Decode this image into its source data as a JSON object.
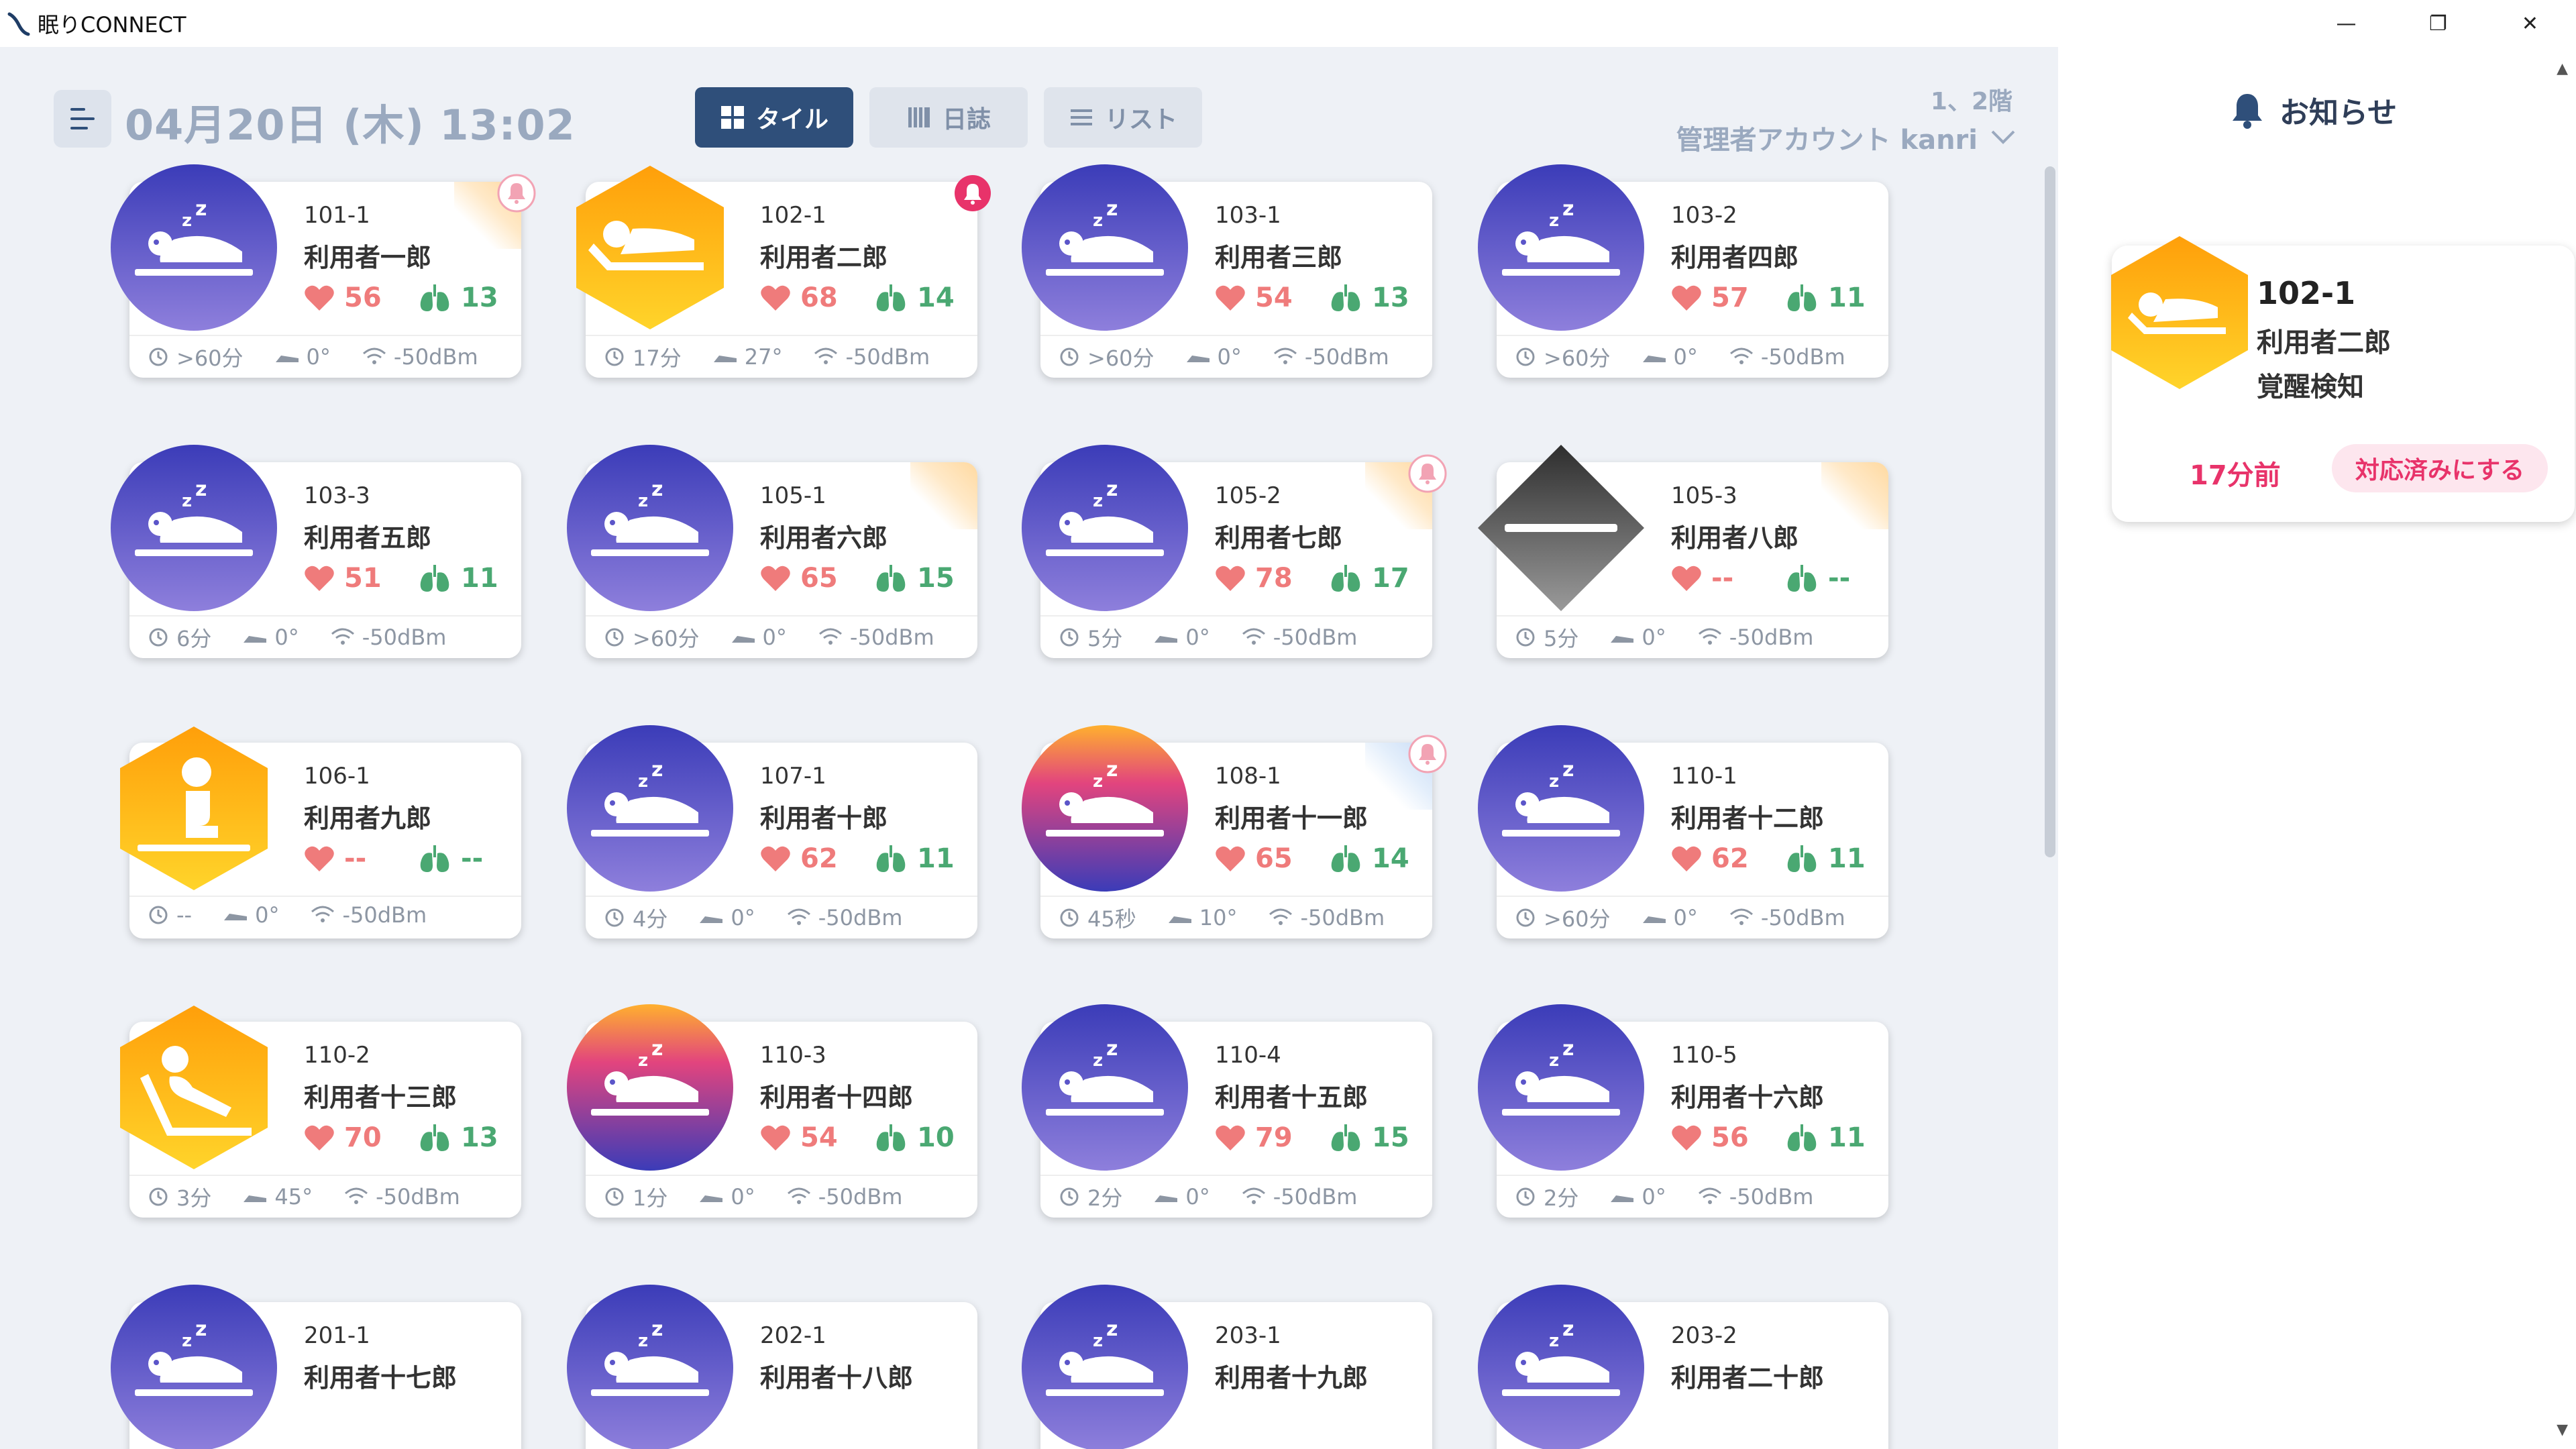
{
  "app": {
    "title": "眠りCONNECT"
  },
  "window": {
    "minimize": "—",
    "restore": "❐",
    "close": "✕"
  },
  "header": {
    "datetime": "04月20日 (木) 13:02",
    "tabs": [
      {
        "label": "タイル",
        "active": true
      },
      {
        "label": "日誌",
        "active": false
      },
      {
        "label": "リスト",
        "active": false
      }
    ],
    "floor": "1、2階",
    "account": "管理者アカウント kanri"
  },
  "colors": {
    "accent": "#2f4f7a",
    "heart": "#ef7b7b",
    "lung": "#4aa872",
    "alert": "#e8336a"
  },
  "tiles": [
    {
      "room": "101-1",
      "name": "利用者一郎",
      "hr": "56",
      "rr": "13",
      "time": ">60分",
      "angle": "0°",
      "signal": "-50dBm",
      "icon": "sleep",
      "badge": "bell",
      "corner": "orange"
    },
    {
      "room": "102-1",
      "name": "利用者二郎",
      "hr": "68",
      "rr": "14",
      "time": "17分",
      "angle": "27°",
      "signal": "-50dBm",
      "icon": "awake-reclined",
      "badge": "alarm",
      "corner": ""
    },
    {
      "room": "103-1",
      "name": "利用者三郎",
      "hr": "54",
      "rr": "13",
      "time": ">60分",
      "angle": "0°",
      "signal": "-50dBm",
      "icon": "sleep",
      "badge": "",
      "corner": ""
    },
    {
      "room": "103-2",
      "name": "利用者四郎",
      "hr": "57",
      "rr": "11",
      "time": ">60分",
      "angle": "0°",
      "signal": "-50dBm",
      "icon": "sleep",
      "badge": "",
      "corner": ""
    },
    {
      "room": "103-3",
      "name": "利用者五郎",
      "hr": "51",
      "rr": "11",
      "time": "6分",
      "angle": "0°",
      "signal": "-50dBm",
      "icon": "sleep",
      "badge": "",
      "corner": ""
    },
    {
      "room": "105-1",
      "name": "利用者六郎",
      "hr": "65",
      "rr": "15",
      "time": ">60分",
      "angle": "0°",
      "signal": "-50dBm",
      "icon": "sleep",
      "badge": "",
      "corner": "orange"
    },
    {
      "room": "105-2",
      "name": "利用者七郎",
      "hr": "78",
      "rr": "17",
      "time": "5分",
      "angle": "0°",
      "signal": "-50dBm",
      "icon": "sleep",
      "badge": "bell",
      "corner": "orange"
    },
    {
      "room": "105-3",
      "name": "利用者八郎",
      "hr": "--",
      "rr": "--",
      "time": "5分",
      "angle": "0°",
      "signal": "-50dBm",
      "icon": "empty",
      "badge": "",
      "corner": "orange"
    },
    {
      "room": "106-1",
      "name": "利用者九郎",
      "hr": "--",
      "rr": "--",
      "time": "--",
      "angle": "0°",
      "signal": "-50dBm",
      "icon": "sitting",
      "badge": "",
      "corner": ""
    },
    {
      "room": "107-1",
      "name": "利用者十郎",
      "hr": "62",
      "rr": "11",
      "time": "4分",
      "angle": "0°",
      "signal": "-50dBm",
      "icon": "sleep",
      "badge": "",
      "corner": ""
    },
    {
      "room": "108-1",
      "name": "利用者十一郎",
      "hr": "65",
      "rr": "14",
      "time": "45秒",
      "angle": "10°",
      "signal": "-50dBm",
      "icon": "sleep-sunset",
      "badge": "bell",
      "corner": "blue"
    },
    {
      "room": "110-1",
      "name": "利用者十二郎",
      "hr": "62",
      "rr": "11",
      "time": ">60分",
      "angle": "0°",
      "signal": "-50dBm",
      "icon": "sleep",
      "badge": "",
      "corner": ""
    },
    {
      "room": "110-2",
      "name": "利用者十三郎",
      "hr": "70",
      "rr": "13",
      "time": "3分",
      "angle": "45°",
      "signal": "-50dBm",
      "icon": "awake-upright",
      "badge": "",
      "corner": ""
    },
    {
      "room": "110-3",
      "name": "利用者十四郎",
      "hr": "54",
      "rr": "10",
      "time": "1分",
      "angle": "0°",
      "signal": "-50dBm",
      "icon": "sleep-sunset",
      "badge": "",
      "corner": ""
    },
    {
      "room": "110-4",
      "name": "利用者十五郎",
      "hr": "79",
      "rr": "15",
      "time": "2分",
      "angle": "0°",
      "signal": "-50dBm",
      "icon": "sleep",
      "badge": "",
      "corner": ""
    },
    {
      "room": "110-5",
      "name": "利用者十六郎",
      "hr": "56",
      "rr": "11",
      "time": "2分",
      "angle": "0°",
      "signal": "-50dBm",
      "icon": "sleep",
      "badge": "",
      "corner": ""
    },
    {
      "room": "201-1",
      "name": "利用者十七郎",
      "hr": "",
      "rr": "",
      "time": "",
      "angle": "",
      "signal": "",
      "icon": "sleep",
      "badge": "",
      "corner": ""
    },
    {
      "room": "202-1",
      "name": "利用者十八郎",
      "hr": "",
      "rr": "",
      "time": "",
      "angle": "",
      "signal": "",
      "icon": "sleep",
      "badge": "",
      "corner": ""
    },
    {
      "room": "203-1",
      "name": "利用者十九郎",
      "hr": "",
      "rr": "",
      "time": "",
      "angle": "",
      "signal": "",
      "icon": "sleep",
      "badge": "",
      "corner": ""
    },
    {
      "room": "203-2",
      "name": "利用者二十郎",
      "hr": "",
      "rr": "",
      "time": "",
      "angle": "",
      "signal": "",
      "icon": "sleep",
      "badge": "",
      "corner": ""
    }
  ],
  "panel": {
    "title": "お知らせ",
    "notice": {
      "room": "102-1",
      "name": "利用者二郎",
      "event": "覚醒検知",
      "time": "17分前",
      "action": "対応済みにする"
    }
  }
}
